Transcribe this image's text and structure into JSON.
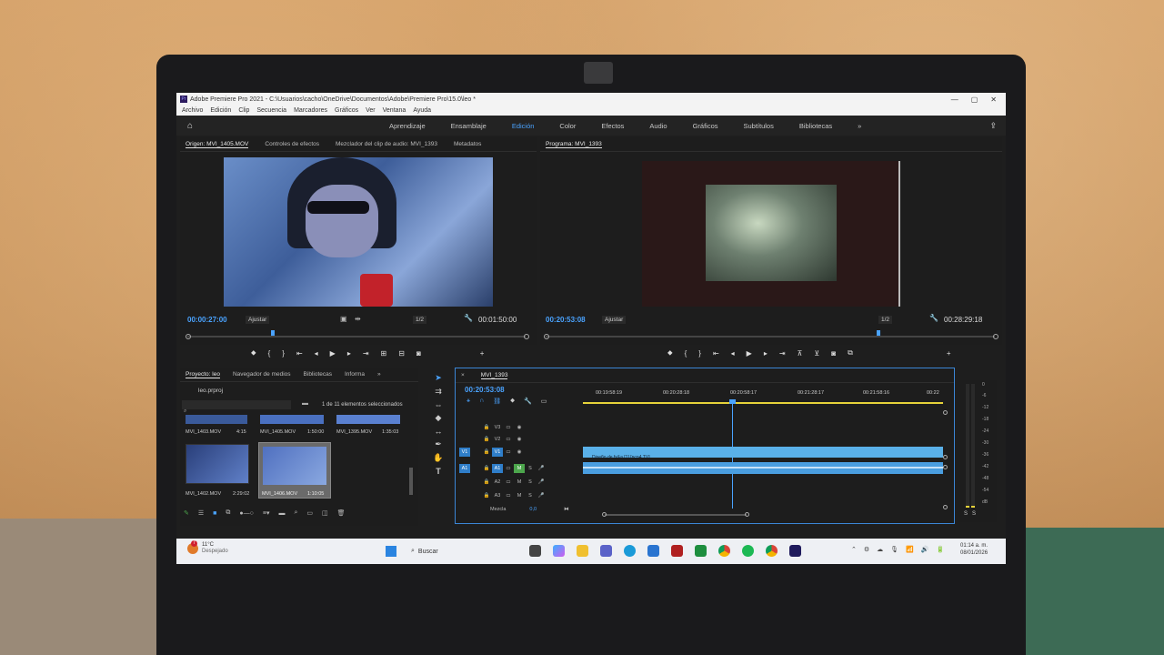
{
  "window": {
    "title": "Adobe Premiere Pro 2021 - C:\\Usuarios\\cacho\\OneDrive\\Documentos\\Adobe\\Premiere Pro\\15.0\\leo *",
    "minimize": "—",
    "maximize": "▢",
    "close": "✕"
  },
  "menu": [
    "Archivo",
    "Edición",
    "Clip",
    "Secuencia",
    "Marcadores",
    "Gráficos",
    "Ver",
    "Ventana",
    "Ayuda"
  ],
  "workspaces": {
    "items": [
      "Aprendizaje",
      "Ensamblaje",
      "Edición",
      "Color",
      "Efectos",
      "Audio",
      "Gráficos",
      "Subtítulos",
      "Bibliotecas"
    ],
    "active": "Edición",
    "more": "»"
  },
  "source": {
    "tabs": [
      "Origen: MVI_1405.MOV",
      "Controles de efectos",
      "Mezclador del clip de audio: MVI_1393",
      "Metadatos"
    ],
    "timecode": "00:00:27:00",
    "fit": "Ajustar",
    "resolution": "1/2",
    "duration": "00:01:50:00"
  },
  "program": {
    "tab": "Programa: MVI_1393",
    "timecode": "00:20:53:08",
    "fit": "Ajustar",
    "resolution": "1/2",
    "duration": "00:28:29:18"
  },
  "project": {
    "tabs": [
      "Proyecto: leo",
      "Navegador de medios",
      "Bibliotecas",
      "Informa"
    ],
    "file": "leo.prproj",
    "selection": "1 de 11 elementos seleccionados",
    "top_clips": [
      {
        "name": "MVI_1403.MOV",
        "duration": "4:15"
      },
      {
        "name": "MVI_1405.MOV",
        "duration": "1:50:00"
      },
      {
        "name": "MVI_1395.MOV",
        "duration": "1:35:03"
      }
    ],
    "clips": [
      {
        "name": "MVI_1402.MOV",
        "duration": "2:29:02"
      },
      {
        "name": "MVI_1406.MOV",
        "duration": "1:10:05"
      }
    ]
  },
  "timeline": {
    "tab": "MVI_1393",
    "timecode": "00:20:53:08",
    "ruler": [
      "00:19:58:19",
      "00:20:28:18",
      "00:20:58:17",
      "00:21:28:17",
      "00:21:58:16",
      "00:22"
    ],
    "tracks": [
      {
        "name": "V3",
        "src": ""
      },
      {
        "name": "V2",
        "src": ""
      },
      {
        "name": "V1",
        "src": "V1"
      },
      {
        "name": "A1",
        "src": "A1"
      },
      {
        "name": "A2",
        "src": ""
      },
      {
        "name": "A3",
        "src": ""
      }
    ],
    "mix_label": "Mezcla",
    "mix_value": "0,0",
    "clip_label": "Diseño de fx&a [1] [ncp4.TV]",
    "m": "M",
    "s": "S"
  },
  "meters": {
    "scale": [
      "0",
      "-6",
      "-12",
      "-18",
      "-24",
      "-30",
      "-36",
      "-42",
      "-48",
      "-54",
      "dB"
    ],
    "bottom": [
      "S",
      "S"
    ]
  },
  "taskbar": {
    "weather_temp": "11°C",
    "weather_desc": "Despejado",
    "search": "Buscar",
    "time": "01:14 a. m.",
    "date": "08/01/2026",
    "badge": "7"
  }
}
